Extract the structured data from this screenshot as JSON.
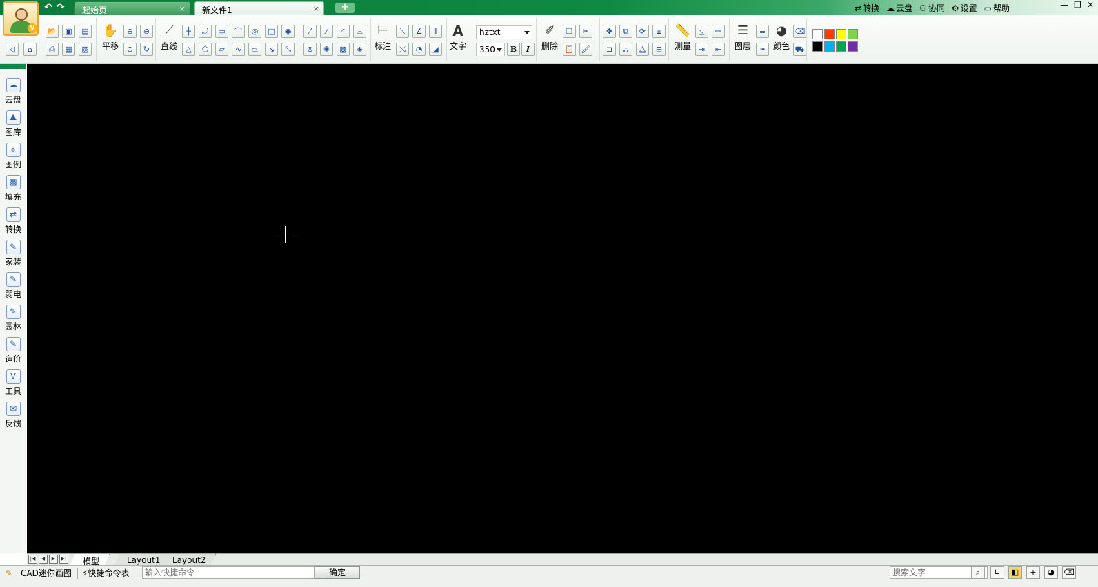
{
  "titlebar": {
    "tabs": [
      {
        "label": "起始页",
        "close": "×"
      },
      {
        "label": "新文件1",
        "close": "×"
      }
    ],
    "new_tab": "+",
    "links": [
      {
        "icon": "⇄",
        "label": "转换"
      },
      {
        "icon": "☁",
        "label": "云盘"
      },
      {
        "icon": "⚇",
        "label": "协同"
      },
      {
        "icon": "⚙",
        "label": "设置"
      },
      {
        "icon": "▭",
        "label": "帮助"
      }
    ],
    "window_controls": [
      "—",
      "❐",
      "✕"
    ]
  },
  "toolbar": {
    "pan_label": "平移",
    "line_label": "直线",
    "dimension_label": "标注",
    "text_label": "文字",
    "font": "hztxt",
    "text_size": "350",
    "bold": "B",
    "italic": "I",
    "delete_label": "删除",
    "measure_label": "测量",
    "layer_label": "图层",
    "color_label": "颜色",
    "swatches": [
      "#ffffff",
      "#ff3c00",
      "#ffff00",
      "#7fd34e",
      "#000000",
      "#00b0f0",
      "#00a651",
      "#7030a0"
    ]
  },
  "sidebar": {
    "items": [
      {
        "label": "云盘",
        "icon": "☁"
      },
      {
        "label": "图库",
        "icon": "⛰"
      },
      {
        "label": "图例",
        "icon": "⌽"
      },
      {
        "label": "填充",
        "icon": "▩"
      },
      {
        "label": "转换",
        "icon": "⇄"
      },
      {
        "label": "家装",
        "icon": "✎"
      },
      {
        "label": "弱电",
        "icon": "✎"
      },
      {
        "label": "园林",
        "icon": "✎"
      },
      {
        "label": "造价",
        "icon": "✎"
      },
      {
        "label": "工具",
        "icon": "V"
      },
      {
        "label": "反馈",
        "icon": "✉"
      }
    ]
  },
  "layout_tabs": [
    "模型",
    "Layout1",
    "Layout2"
  ],
  "status": {
    "app_name": "CAD迷你画图",
    "quick_cmd": "快捷命令表",
    "cmd_placeholder": "输入快捷命令",
    "ok": "确定",
    "search_placeholder": "搜索文字"
  }
}
